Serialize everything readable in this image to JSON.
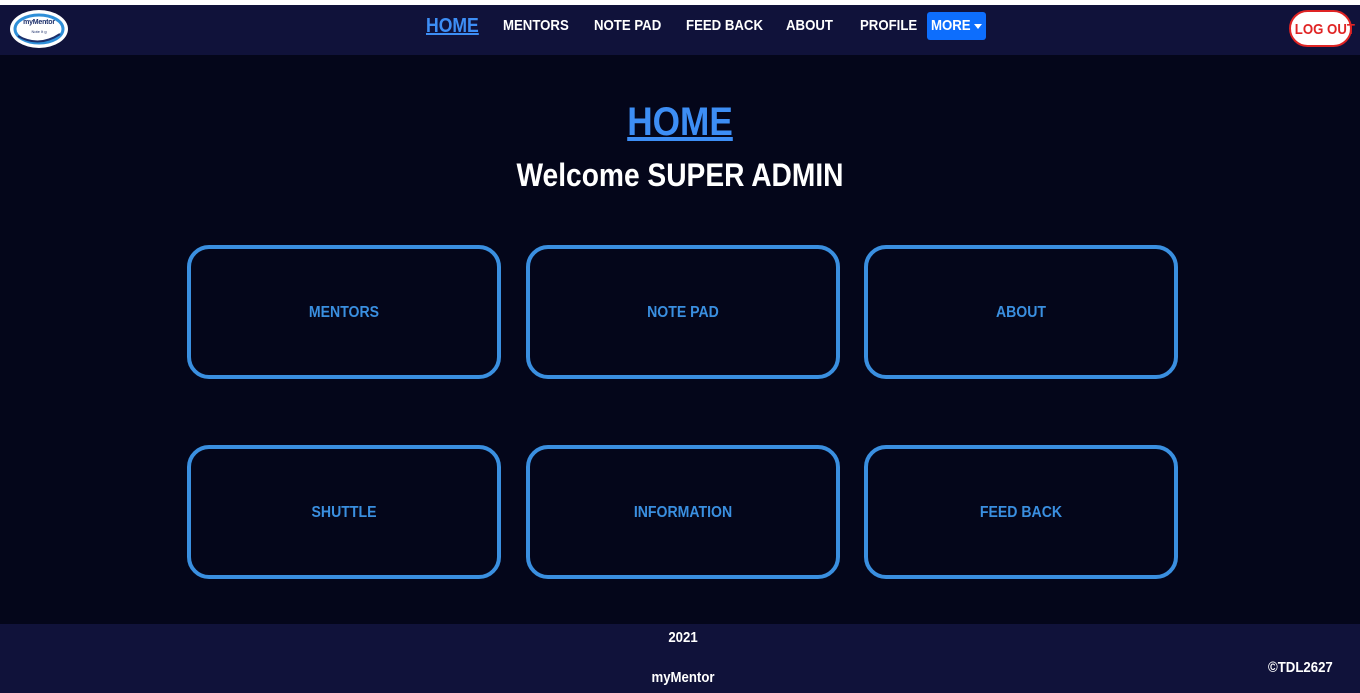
{
  "navbar": {
    "logo": {
      "text": "myMentor",
      "subtext": "Note It g"
    },
    "links": [
      {
        "label": "HOME",
        "active": true
      },
      {
        "label": "MENTORS"
      },
      {
        "label": "NOTE PAD"
      },
      {
        "label": "FEED BACK"
      },
      {
        "label": "ABOUT"
      },
      {
        "label": "PROFILE"
      }
    ],
    "more_label": "MORE",
    "more_icon": "caret-down-icon",
    "logout_label": "LOG OUT"
  },
  "main": {
    "title": "HOME",
    "welcome": "Welcome SUPER ADMIN",
    "cards": [
      {
        "label": "MENTORS"
      },
      {
        "label": "NOTE PAD"
      },
      {
        "label": "ABOUT"
      },
      {
        "label": "SHUTTLE"
      },
      {
        "label": "INFORMATION"
      },
      {
        "label": "FEED BACK"
      }
    ]
  },
  "footer": {
    "year": "2021",
    "app_name": "myMentor",
    "copyright": "©TDL2627"
  },
  "colors": {
    "background": "#04061a",
    "navbar": "#10123a",
    "accent": "#3d8ef5",
    "card_border": "#3a8fe0",
    "more_button": "#0d6efd",
    "logout": "#e02424"
  }
}
